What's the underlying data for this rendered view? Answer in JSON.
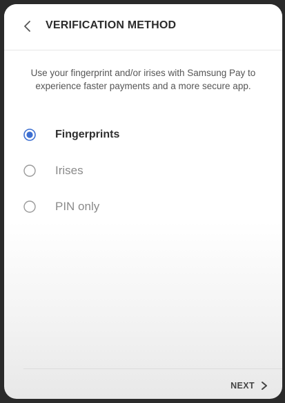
{
  "header": {
    "title": "VERIFICATION METHOD",
    "back_icon": "chevron-left-icon"
  },
  "description": "Use your fingerprint and/or irises with Samsung Pay to experience faster payments and a more secure app.",
  "options": [
    {
      "label": "Fingerprints",
      "selected": true
    },
    {
      "label": "Irises",
      "selected": false
    },
    {
      "label": "PIN only",
      "selected": false
    }
  ],
  "footer": {
    "next_label": "NEXT",
    "next_icon": "chevron-right-icon"
  },
  "colors": {
    "accent": "#3d6fd1",
    "radio_unselected": "#9a9a9a"
  }
}
